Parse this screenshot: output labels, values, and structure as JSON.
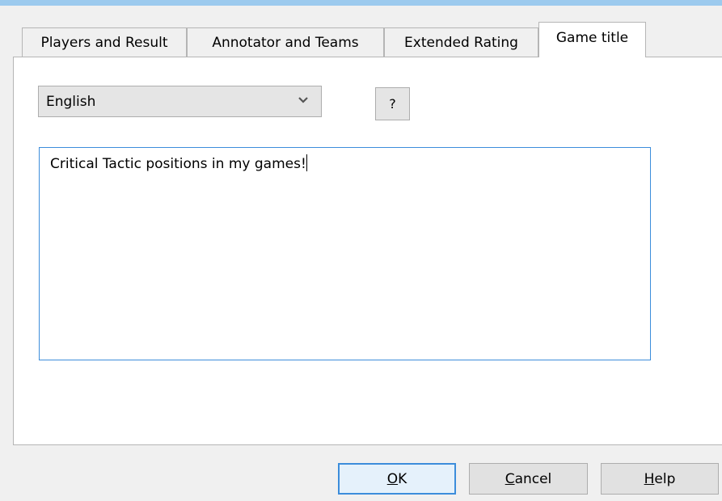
{
  "tabs": [
    {
      "label": "Players and Result"
    },
    {
      "label": "Annotator and Teams"
    },
    {
      "label": "Extended Rating"
    },
    {
      "label": "Game title"
    }
  ],
  "language_select": {
    "value": "English"
  },
  "help_small_button": {
    "label": "?"
  },
  "title_text": {
    "value": "Critical Tactic positions in my games!"
  },
  "buttons": {
    "ok": {
      "mnemonic": "O",
      "rest": "K"
    },
    "cancel": {
      "mnemonic": "C",
      "rest": "ancel"
    },
    "help": {
      "mnemonic": "H",
      "rest": "elp"
    }
  },
  "colors": {
    "accent": "#3c8ddb",
    "title_strip": "#9ccaee",
    "window_bg": "#f0f0f0"
  }
}
